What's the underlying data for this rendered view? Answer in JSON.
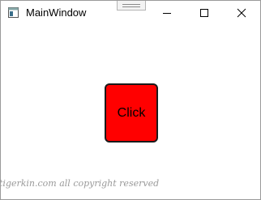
{
  "window": {
    "title": "MainWindow",
    "icons": {
      "app": "window-app-icon",
      "minimize": "minimize-icon",
      "maximize": "maximize-icon",
      "close": "close-icon"
    }
  },
  "content": {
    "button_label": "Click",
    "button_color": "#ff0000"
  },
  "watermark": "tigerkin.com all copyright reserved"
}
